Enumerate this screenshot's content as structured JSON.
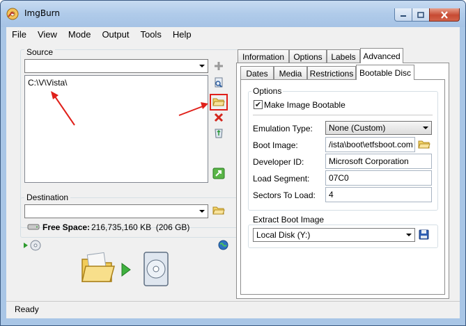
{
  "window": {
    "title": "ImgBurn"
  },
  "menu": [
    "File",
    "View",
    "Mode",
    "Output",
    "Tools",
    "Help"
  ],
  "source": {
    "label": "Source",
    "selected": "",
    "files": [
      "C:\\V\\Vista\\"
    ]
  },
  "destination": {
    "label": "Destination",
    "selected": "",
    "free_space_label": "Free Space:",
    "free_space_value": "216,735,160 KB  (206 GB)"
  },
  "tabs_row1": [
    "Information",
    "Options",
    "Labels",
    "Advanced"
  ],
  "tabs_row2": [
    "Dates",
    "Media",
    "Restrictions",
    "Bootable Disc"
  ],
  "options": {
    "title": "Options",
    "make_bootable_label": "Make Image Bootable",
    "make_bootable_checked": true,
    "emulation_type_label": "Emulation Type:",
    "emulation_type_value": "None (Custom)",
    "boot_image_label": "Boot Image:",
    "boot_image_value": "/ista\\boot\\etfsboot.com",
    "developer_id_label": "Developer ID:",
    "developer_id_value": "Microsoft Corporation",
    "load_segment_label": "Load Segment:",
    "load_segment_value": "07C0",
    "sectors_to_load_label": "Sectors To Load:",
    "sectors_to_load_value": "4"
  },
  "extract": {
    "title": "Extract Boot Image",
    "drive_value": "Local Disk (Y:)"
  },
  "status": {
    "text": "Ready"
  },
  "colors": {
    "annotation": "#e0201a",
    "title_bar": "#b0cbea",
    "menu_bg": "#f0f0f0"
  },
  "icons": [
    "imgburn-app-icon",
    "add-icon",
    "browse-file-icon",
    "browse-folder-icon",
    "remove-icon",
    "recycle-icon",
    "calculate-icon",
    "folder-icon",
    "hdd-icon",
    "disc-icon",
    "globe-icon",
    "build-folder-icon",
    "build-arrow-icon",
    "build-disc-icon",
    "save-icon"
  ]
}
